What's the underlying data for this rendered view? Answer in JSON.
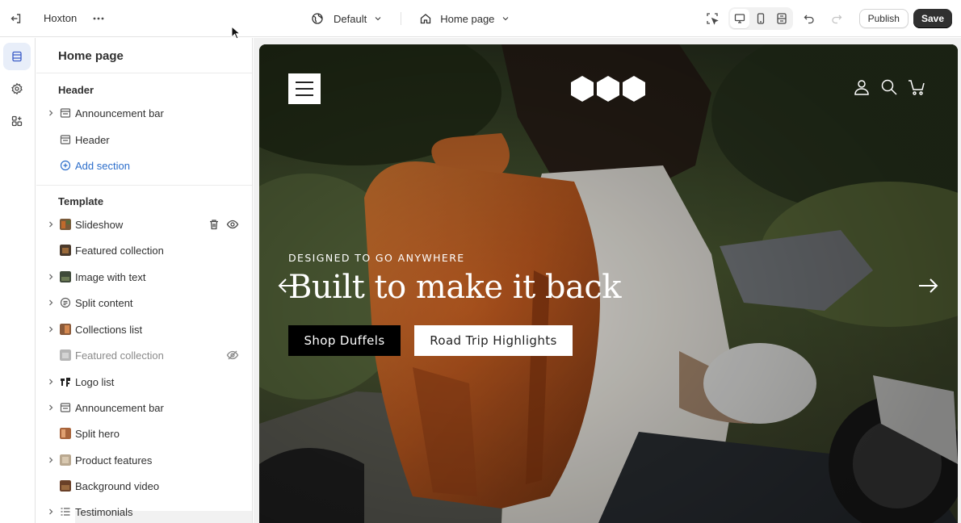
{
  "topbar": {
    "store_name": "Hoxton",
    "theme_selector": "Default",
    "page_selector": "Home page",
    "publish_label": "Publish",
    "save_label": "Save"
  },
  "rail": {
    "items": [
      {
        "icon": "sections-icon",
        "active": true
      },
      {
        "icon": "settings-gear-icon",
        "active": false
      },
      {
        "icon": "apps-icon",
        "active": false
      }
    ]
  },
  "sidebar": {
    "title": "Home page",
    "header_group": {
      "title": "Header",
      "items": [
        {
          "label": "Announcement bar",
          "icon": "layout-rows-icon",
          "expandable": true
        },
        {
          "label": "Header",
          "icon": "layout-rows-icon",
          "expandable": false
        }
      ],
      "add_section_label": "Add section"
    },
    "template_group": {
      "title": "Template",
      "items": [
        {
          "label": "Slideshow",
          "icon": "image-thumb-icon",
          "expandable": true,
          "hidden": false,
          "hovered": true
        },
        {
          "label": "Featured collection",
          "icon": "image-thumb-icon",
          "expandable": false,
          "hidden": false
        },
        {
          "label": "Image with text",
          "icon": "image-thumb-icon",
          "expandable": true,
          "hidden": false
        },
        {
          "label": "Split content",
          "icon": "text-block-icon",
          "expandable": true,
          "hidden": false
        },
        {
          "label": "Collections list",
          "icon": "image-thumb-icon",
          "expandable": true,
          "hidden": false
        },
        {
          "label": "Featured collection",
          "icon": "image-thumb-icon",
          "expandable": false,
          "hidden": true
        },
        {
          "label": "Logo list",
          "icon": "logo-thumb-icon",
          "expandable": true,
          "hidden": false
        },
        {
          "label": "Announcement bar",
          "icon": "layout-rows-icon",
          "expandable": true,
          "hidden": false
        },
        {
          "label": "Split hero",
          "icon": "image-thumb-icon",
          "expandable": false,
          "hidden": false
        },
        {
          "label": "Product features",
          "icon": "image-thumb-icon",
          "expandable": true,
          "hidden": false
        },
        {
          "label": "Background video",
          "icon": "image-thumb-icon",
          "expandable": false,
          "hidden": false
        },
        {
          "label": "Testimonials",
          "icon": "list-icon",
          "expandable": true,
          "hidden": false
        }
      ]
    }
  },
  "preview": {
    "eyebrow": "DESIGNED TO GO ANYWHERE",
    "headline": "Built to make it back",
    "cta_primary": "Shop Duffels",
    "cta_secondary": "Road Trip Highlights"
  },
  "colors": {
    "accent_blue": "#2c6ecb",
    "save_button": "#303030",
    "backpack_orange": "#b8571f",
    "foliage_green": "#4d5c33"
  }
}
